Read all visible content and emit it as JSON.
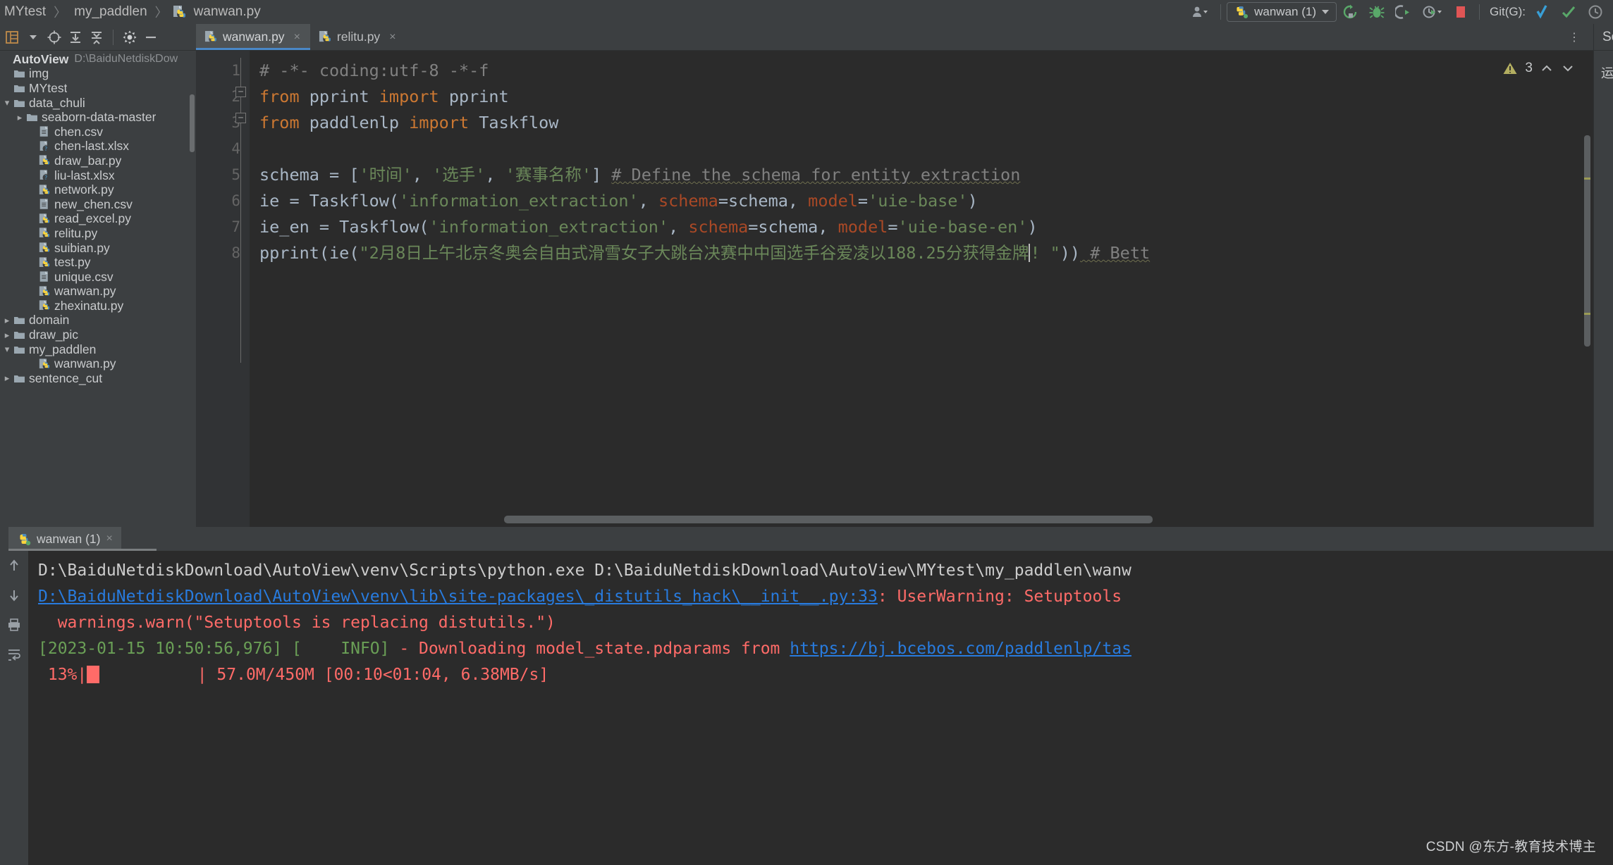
{
  "navbar": {
    "breadcrumbs": [
      {
        "label": "MYtest",
        "icon": "none"
      },
      {
        "label": "my_paddlen",
        "icon": "none"
      },
      {
        "label": "wanwan.py",
        "icon": "python-file-icon"
      }
    ],
    "separator": "〉",
    "account_icon": "account-icon",
    "run_config": {
      "label": "wanwan (1)",
      "icon": "python-config-icon",
      "caret": "▾"
    },
    "actions": [
      {
        "name": "rerun-button",
        "icon": "rerun-icon",
        "color": "#59a869"
      },
      {
        "name": "debug-button",
        "icon": "bug-icon",
        "color": "#59a869"
      },
      {
        "name": "run-with-coverage-button",
        "icon": "coverage-icon",
        "color": "#9aa0a6"
      },
      {
        "name": "profile-button",
        "icon": "profiler-icon",
        "color": "#59a869"
      },
      {
        "name": "stop-button",
        "icon": "stop-square-icon",
        "color": "#e05555"
      }
    ],
    "git_label": "Git(G):",
    "git_actions": [
      {
        "name": "update-project-button",
        "icon": "update-arrow-icon",
        "color": "#389fd6"
      },
      {
        "name": "commit-button",
        "icon": "check-icon",
        "color": "#59a869"
      },
      {
        "name": "history-button",
        "icon": "clock-icon",
        "color": "#8d9093"
      }
    ]
  },
  "left_toolbar": {
    "buttons": [
      {
        "name": "project-view-button",
        "icon": "project-structure-icon"
      },
      {
        "name": "view-options-dropdown",
        "icon": "chevron-down-icon"
      },
      {
        "name": "locate-file-button",
        "icon": "target-icon"
      },
      {
        "name": "expand-all-button",
        "icon": "expand-all-icon"
      },
      {
        "name": "collapse-all-button",
        "icon": "collapse-all-icon"
      },
      {
        "name": "settings-button",
        "icon": "gear-icon"
      },
      {
        "name": "hide-panel-button",
        "icon": "minus-icon"
      }
    ]
  },
  "project_tree": {
    "root": {
      "label": "AutoView",
      "path": "D:\\BaiduNetdiskDow",
      "type": "root"
    },
    "items": [
      {
        "label": "img",
        "type": "folder",
        "indent": 0,
        "arrow": ""
      },
      {
        "label": "MYtest",
        "type": "folder",
        "indent": 0,
        "arrow": ""
      },
      {
        "label": "data_chuli",
        "type": "folder",
        "indent": 0,
        "arrow": "⌄"
      },
      {
        "label": "seaborn-data-master",
        "type": "folder",
        "indent": 1,
        "arrow": "›"
      },
      {
        "label": "chen.csv",
        "type": "csv",
        "indent": 2,
        "arrow": ""
      },
      {
        "label": "chen-last.xlsx",
        "type": "xlsx",
        "indent": 2,
        "arrow": ""
      },
      {
        "label": "draw_bar.py",
        "type": "py",
        "indent": 2,
        "arrow": ""
      },
      {
        "label": "liu-last.xlsx",
        "type": "xlsx",
        "indent": 2,
        "arrow": ""
      },
      {
        "label": "network.py",
        "type": "py",
        "indent": 2,
        "arrow": ""
      },
      {
        "label": "new_chen.csv",
        "type": "csv",
        "indent": 2,
        "arrow": ""
      },
      {
        "label": "read_excel.py",
        "type": "py",
        "indent": 2,
        "arrow": ""
      },
      {
        "label": "relitu.py",
        "type": "py",
        "indent": 2,
        "arrow": ""
      },
      {
        "label": "suibian.py",
        "type": "py",
        "indent": 2,
        "arrow": ""
      },
      {
        "label": "test.py",
        "type": "py",
        "indent": 2,
        "arrow": ""
      },
      {
        "label": "unique.csv",
        "type": "csv",
        "indent": 2,
        "arrow": ""
      },
      {
        "label": "wanwan.py",
        "type": "py",
        "indent": 2,
        "arrow": ""
      },
      {
        "label": "zhexinatu.py",
        "type": "py",
        "indent": 2,
        "arrow": ""
      },
      {
        "label": "domain",
        "type": "folder",
        "indent": 0,
        "arrow": "›"
      },
      {
        "label": "draw_pic",
        "type": "folder",
        "indent": 0,
        "arrow": "›"
      },
      {
        "label": "my_paddlen",
        "type": "folder",
        "indent": 0,
        "arrow": "⌄"
      },
      {
        "label": "wanwan.py",
        "type": "py",
        "indent": 2,
        "arrow": ""
      },
      {
        "label": "sentence_cut",
        "type": "folder",
        "indent": 0,
        "arrow": "›"
      }
    ]
  },
  "editor": {
    "tabs": [
      {
        "label": "wanwan.py",
        "active": true,
        "close": "×",
        "icon": "python-file-icon"
      },
      {
        "label": "relitu.py",
        "active": false,
        "close": "×",
        "icon": "python-file-icon"
      }
    ],
    "more_icon": "⋮",
    "warning_count": "3",
    "warning_icon": "warning-triangle-icon",
    "chevron_up": "⌃",
    "chevron_down": "⌄",
    "line_numbers": [
      "1",
      "2",
      "3",
      "4",
      "5",
      "6",
      "7",
      "8"
    ],
    "lines": [
      {
        "n": 1,
        "tokens": [
          {
            "t": "# -*- coding:utf-8 -*-f",
            "c": "cmt"
          }
        ]
      },
      {
        "n": 2,
        "tokens": [
          {
            "t": "from",
            "c": "kw"
          },
          {
            "t": " pprint ",
            "c": "id"
          },
          {
            "t": "import",
            "c": "kw"
          },
          {
            "t": " pprint",
            "c": "id"
          }
        ]
      },
      {
        "n": 3,
        "tokens": [
          {
            "t": "from",
            "c": "kw"
          },
          {
            "t": " paddlenlp ",
            "c": "id"
          },
          {
            "t": "import",
            "c": "kw"
          },
          {
            "t": " Taskflow",
            "c": "id"
          }
        ]
      },
      {
        "n": 4,
        "tokens": [
          {
            "t": "",
            "c": "id"
          }
        ]
      },
      {
        "n": 5,
        "tokens": [
          {
            "t": "schema = [",
            "c": "id"
          },
          {
            "t": "'时间'",
            "c": "str"
          },
          {
            "t": ", ",
            "c": "id"
          },
          {
            "t": "'选手'",
            "c": "str"
          },
          {
            "t": ", ",
            "c": "id"
          },
          {
            "t": "'赛事名称'",
            "c": "str"
          },
          {
            "t": "] ",
            "c": "id"
          },
          {
            "t": "# Define the schema for entity extraction",
            "c": "cmt"
          }
        ]
      },
      {
        "n": 6,
        "tokens": [
          {
            "t": "ie = Taskflow(",
            "c": "id"
          },
          {
            "t": "'information_extraction'",
            "c": "str"
          },
          {
            "t": ", ",
            "c": "id"
          },
          {
            "t": "schema",
            "c": "kwarg"
          },
          {
            "t": "=schema, ",
            "c": "id"
          },
          {
            "t": "model",
            "c": "kwarg"
          },
          {
            "t": "=",
            "c": "id"
          },
          {
            "t": "'uie-base'",
            "c": "str"
          },
          {
            "t": ")",
            "c": "id"
          }
        ]
      },
      {
        "n": 7,
        "tokens": [
          {
            "t": "ie_en = Taskflow(",
            "c": "id"
          },
          {
            "t": "'information_extraction'",
            "c": "str"
          },
          {
            "t": ", ",
            "c": "id"
          },
          {
            "t": "schema",
            "c": "kwarg"
          },
          {
            "t": "=schema, ",
            "c": "id"
          },
          {
            "t": "model",
            "c": "kwarg"
          },
          {
            "t": "=",
            "c": "id"
          },
          {
            "t": "'uie-base-en'",
            "c": "str"
          },
          {
            "t": ")",
            "c": "id"
          }
        ]
      },
      {
        "n": 8,
        "tokens": [
          {
            "t": "pprint(ie(",
            "c": "id"
          },
          {
            "t": "\"2月8日上午北京冬奥会自由式滑雪女子大跳台决赛中中国选手谷爱凌以188.25分获得金牌",
            "c": "str"
          },
          {
            "t": "CURSOR",
            "c": "caret"
          },
          {
            "t": "! \"",
            "c": "str"
          },
          {
            "t": "))",
            "c": "id"
          },
          {
            "t": " # Bett",
            "c": "cmt"
          }
        ]
      }
    ]
  },
  "sciview": {
    "title": "SciView:",
    "sub": "运行 Python "
  },
  "run_panel": {
    "tab": {
      "label": "wanwan (1)",
      "close": "×",
      "icon": "python-run-icon"
    },
    "side_buttons": [
      {
        "name": "scroll-up-button",
        "icon": "arrow-up-icon"
      },
      {
        "name": "scroll-down-button",
        "icon": "arrow-down-icon"
      },
      {
        "name": "print-button",
        "icon": "printer-icon"
      },
      {
        "name": "soft-wrap-button",
        "icon": "wrap-icon"
      }
    ],
    "output": [
      {
        "segments": [
          {
            "t": "D:\\BaiduNetdiskDownload\\AutoView\\venv\\Scripts\\python.exe D:\\BaiduNetdiskDownload\\AutoView\\MYtest\\my_paddlen\\wanw",
            "c": "plain"
          }
        ]
      },
      {
        "segments": [
          {
            "t": "D:\\BaiduNetdiskDownload\\AutoView\\venv\\lib\\site-packages\\_distutils_hack\\__init__.py:33",
            "c": "link"
          },
          {
            "t": ": ",
            "c": "err"
          },
          {
            "t": "UserWarning: Setuptools",
            "c": "err"
          }
        ]
      },
      {
        "segments": [
          {
            "t": "  warnings.warn(\"Setuptools is replacing distutils.\")",
            "c": "err"
          }
        ]
      },
      {
        "segments": [
          {
            "t": "[2023-01-15 10:50:56,976] [",
            "c": "grn"
          },
          {
            "t": "    INFO",
            "c": "grn"
          },
          {
            "t": "]",
            "c": "grn"
          },
          {
            "t": " - Downloading model_state.pdparams from ",
            "c": "err"
          },
          {
            "t": "https://bj.bcebos.com/paddlenlp/tas",
            "c": "link"
          }
        ]
      },
      {
        "segments": [
          {
            "t": " 13%|",
            "c": "err"
          },
          {
            "t": "BLOCK",
            "c": "block"
          },
          {
            "t": "          | 57.0M/450M [00:10<01:04, 6.38MB/s]",
            "c": "err"
          }
        ]
      }
    ]
  },
  "watermark": "CSDN @东方-教育技术博主",
  "colors": {
    "bg_chrome": "#3c3f41",
    "bg_editor": "#2b2b2b",
    "accent_blue": "#4a88c7",
    "string_green": "#6a8759",
    "keyword_orange": "#cc7832",
    "error_red": "#ff6b68",
    "link_blue": "#287bde",
    "log_green": "#6a9f56"
  }
}
